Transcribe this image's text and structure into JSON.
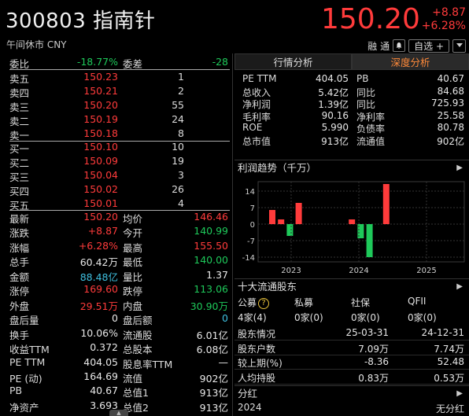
{
  "header": {
    "code": "300803",
    "name": "指南针",
    "status": "午间休市 CNY",
    "price": "150.20",
    "change": "+8.87",
    "change_pct": "+6.28%",
    "tool1": "融",
    "tool2": "通",
    "watch_label": "自选 +",
    "menu_icon": "chevron-down-icon"
  },
  "order_book": {
    "weibi_label": "委比",
    "weibi_value": "-18.77%",
    "weicha_label": "委差",
    "weicha_value": "-28",
    "asks": [
      {
        "label": "卖五",
        "price": "150.23",
        "qty": "1"
      },
      {
        "label": "卖四",
        "price": "150.21",
        "qty": "2"
      },
      {
        "label": "卖三",
        "price": "150.20",
        "qty": "55"
      },
      {
        "label": "卖二",
        "price": "150.19",
        "qty": "24"
      },
      {
        "label": "卖一",
        "price": "150.18",
        "qty": "8"
      }
    ],
    "bids": [
      {
        "label": "买一",
        "price": "150.10",
        "qty": "10"
      },
      {
        "label": "买二",
        "price": "150.09",
        "qty": "19"
      },
      {
        "label": "买三",
        "price": "150.04",
        "qty": "3"
      },
      {
        "label": "买四",
        "price": "150.02",
        "qty": "26"
      },
      {
        "label": "买五",
        "price": "150.01",
        "qty": "4"
      }
    ]
  },
  "quote": [
    {
      "l1": "最新",
      "v1": "150.20",
      "c1": "red",
      "l2": "均价",
      "v2": "146.46",
      "c2": "red"
    },
    {
      "l1": "涨跌",
      "v1": "+8.87",
      "c1": "red",
      "l2": "今开",
      "v2": "140.99",
      "c2": "green"
    },
    {
      "l1": "涨幅",
      "v1": "+6.28%",
      "c1": "red",
      "l2": "最高",
      "v2": "155.50",
      "c2": "red"
    },
    {
      "l1": "总手",
      "v1": "60.42万",
      "c1": "white",
      "l2": "最低",
      "v2": "140.00",
      "c2": "green"
    },
    {
      "l1": "金额",
      "v1": "88.48亿",
      "c1": "cyan",
      "l2": "量比",
      "v2": "1.37",
      "c2": "white"
    },
    {
      "l1": "涨停",
      "v1": "169.60",
      "c1": "red",
      "l2": "跌停",
      "v2": "113.06",
      "c2": "green"
    },
    {
      "l1": "外盘",
      "v1": "29.51万",
      "c1": "red",
      "l2": "内盘",
      "v2": "30.90万",
      "c2": "green"
    },
    {
      "l1": "盘后量",
      "v1": "0",
      "c1": "white",
      "l2": "盘后额",
      "v2": "0",
      "c2": "cyan"
    },
    {
      "l1": "换手",
      "v1": "10.06%",
      "c1": "white",
      "l2": "流通股",
      "v2": "6.01亿",
      "c2": "white"
    },
    {
      "l1": "收益TTM",
      "v1": "0.372",
      "c1": "white",
      "l2": "总股本",
      "v2": "6.08亿",
      "c2": "white"
    },
    {
      "l1": "PE TTM",
      "v1": "404.05",
      "c1": "white",
      "l2": "股息率TTM",
      "v2": "—",
      "c2": "white"
    },
    {
      "l1": "PE (动)",
      "v1": "164.69",
      "c1": "white",
      "l2": "流值",
      "v2": "902亿",
      "c2": "white"
    },
    {
      "l1": "PB",
      "v1": "40.67",
      "c1": "white",
      "l2": "总值1",
      "v2": "913亿",
      "c2": "white"
    },
    {
      "l1": "净资产",
      "v1": "3.693",
      "c1": "white",
      "l2": "总值2",
      "v2": "913亿",
      "c2": "white"
    }
  ],
  "tabs": [
    "行情分析",
    "深度分析"
  ],
  "fundamentals": [
    {
      "l1": "PE TTM",
      "v1": "404.05",
      "l2": "PB",
      "v2": "40.67"
    },
    {
      "l1": "总收入",
      "v1": "5.42亿",
      "l2": "同比",
      "v2": "84.68"
    },
    {
      "l1": "净利润",
      "v1": "1.39亿",
      "l2": "同比",
      "v2": "725.93"
    },
    {
      "l1": "毛利率",
      "v1": "90.16",
      "l2": "净利率",
      "v2": "25.58"
    },
    {
      "l1": "ROE",
      "v1": "5.990",
      "l2": "负债率",
      "v2": "80.78"
    },
    {
      "l1": "总市值",
      "v1": "913亿",
      "l2": "流通值",
      "v2": "902亿"
    }
  ],
  "profit_trend": {
    "title": "利润趋势（千万）"
  },
  "chart_data": {
    "type": "bar",
    "title": "利润趋势（千万）",
    "yticks": [
      14,
      7,
      0,
      -7,
      -14
    ],
    "ylim": [
      -16,
      18
    ],
    "xticks": [
      "2023",
      "2024",
      "2025"
    ],
    "colors": {
      "positive": "#ff3b3b",
      "negative": "#1ec95a"
    },
    "bars": [
      {
        "period": "2022Q4",
        "value": 6
      },
      {
        "period": "2023Q1",
        "value": 2
      },
      {
        "period": "2023Q2",
        "value": -5
      },
      {
        "period": "2023Q3",
        "value": 9
      },
      {
        "period": "2023Q4",
        "value": 0
      },
      {
        "period": "2024Q1",
        "value": 0
      },
      {
        "period": "2024Q2",
        "value": 2
      },
      {
        "period": "2024Q3",
        "value": -6
      },
      {
        "period": "2024Q4",
        "value": -14
      },
      {
        "period": "2025Q1",
        "value": 17
      }
    ]
  },
  "holders": {
    "title": "十大流通股东",
    "categories": [
      {
        "label": "公募",
        "count": "4家(4)"
      },
      {
        "label": "私募",
        "count": "0家(0)"
      },
      {
        "label": "社保",
        "count": "0家(0)"
      },
      {
        "label": "QFII",
        "count": "0家(0)"
      }
    ],
    "rows": [
      {
        "label": "股东情况",
        "c1": "25-03-31",
        "c2": "24-12-31"
      },
      {
        "label": "股东户数",
        "c1": "7.09万",
        "c2": "7.74万"
      },
      {
        "label": "较上期(%)",
        "c1": "-8.36",
        "c2": "52.48"
      },
      {
        "label": "人均持股",
        "c1": "0.83万",
        "c2": "0.53万"
      }
    ]
  },
  "dividend": {
    "title": "分红",
    "year": "2024",
    "value": "无分红"
  }
}
